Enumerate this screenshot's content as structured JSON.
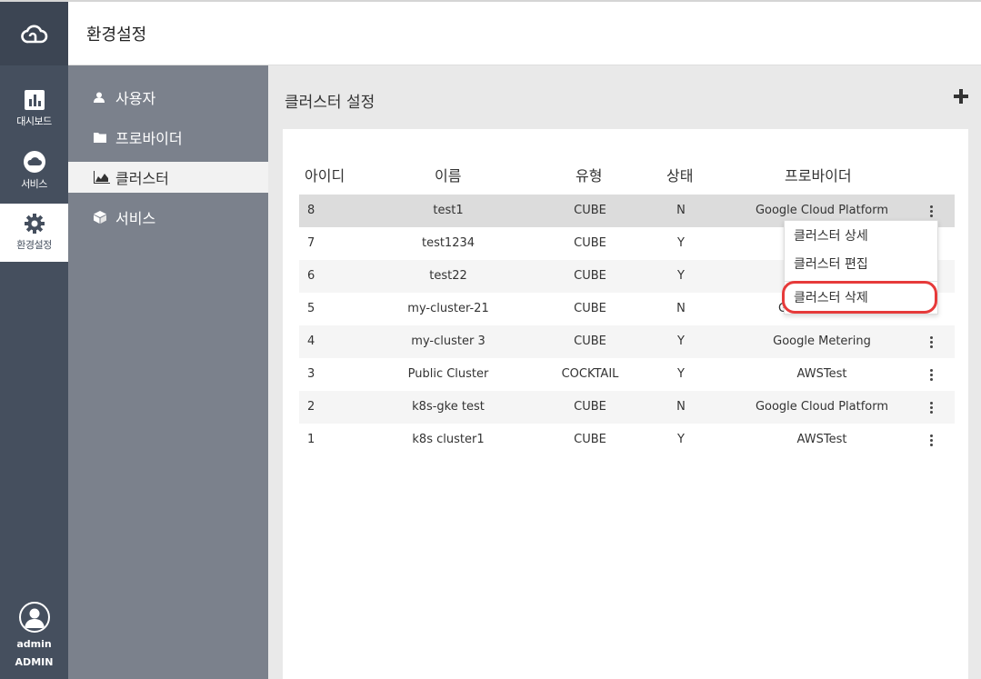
{
  "header": {
    "title": "환경설정"
  },
  "rail": {
    "items": [
      {
        "label": "대시보드",
        "icon": "bar-chart-icon"
      },
      {
        "label": "서비스",
        "icon": "cloud-icon"
      },
      {
        "label": "환경설정",
        "icon": "gear-icon"
      }
    ],
    "user": {
      "name": "admin",
      "role": "ADMIN"
    }
  },
  "submenu": {
    "items": [
      {
        "label": "사용자",
        "icon": "user-icon"
      },
      {
        "label": "프로바이더",
        "icon": "folder-icon"
      },
      {
        "label": "클러스터",
        "icon": "area-chart-icon"
      },
      {
        "label": "서비스",
        "icon": "cube-icon"
      }
    ]
  },
  "main": {
    "title": "클러스터 설정",
    "add_icon": "plus-icon",
    "columns": {
      "id": "아이디",
      "name": "이름",
      "type": "유형",
      "state": "상태",
      "provider": "프로바이더"
    },
    "rows": [
      {
        "id": "8",
        "name": "test1",
        "type": "CUBE",
        "state": "N",
        "provider": "Google Cloud Platform"
      },
      {
        "id": "7",
        "name": "test1234",
        "type": "CUBE",
        "state": "Y",
        "provider": ""
      },
      {
        "id": "6",
        "name": "test22",
        "type": "CUBE",
        "state": "Y",
        "provider": ""
      },
      {
        "id": "5",
        "name": "my-cluster-21",
        "type": "CUBE",
        "state": "N",
        "provider": "Goog"
      },
      {
        "id": "4",
        "name": "my-cluster 3",
        "type": "CUBE",
        "state": "Y",
        "provider": "Google Metering"
      },
      {
        "id": "3",
        "name": "Public Cluster",
        "type": "COCKTAIL",
        "state": "Y",
        "provider": "AWSTest"
      },
      {
        "id": "2",
        "name": "k8s-gke test",
        "type": "CUBE",
        "state": "N",
        "provider": "Google Cloud Platform"
      },
      {
        "id": "1",
        "name": "k8s cluster1",
        "type": "CUBE",
        "state": "Y",
        "provider": "AWSTest"
      }
    ],
    "context_menu": {
      "items": [
        {
          "label": "클러스터 상세"
        },
        {
          "label": "클러스터 편집"
        },
        {
          "label": "클러스터 삭제"
        }
      ],
      "highlight_color": "#e63a3a"
    }
  },
  "colors": {
    "rail": "#454f5e",
    "submenu": "#7b818c",
    "background": "#e9e9e9"
  }
}
